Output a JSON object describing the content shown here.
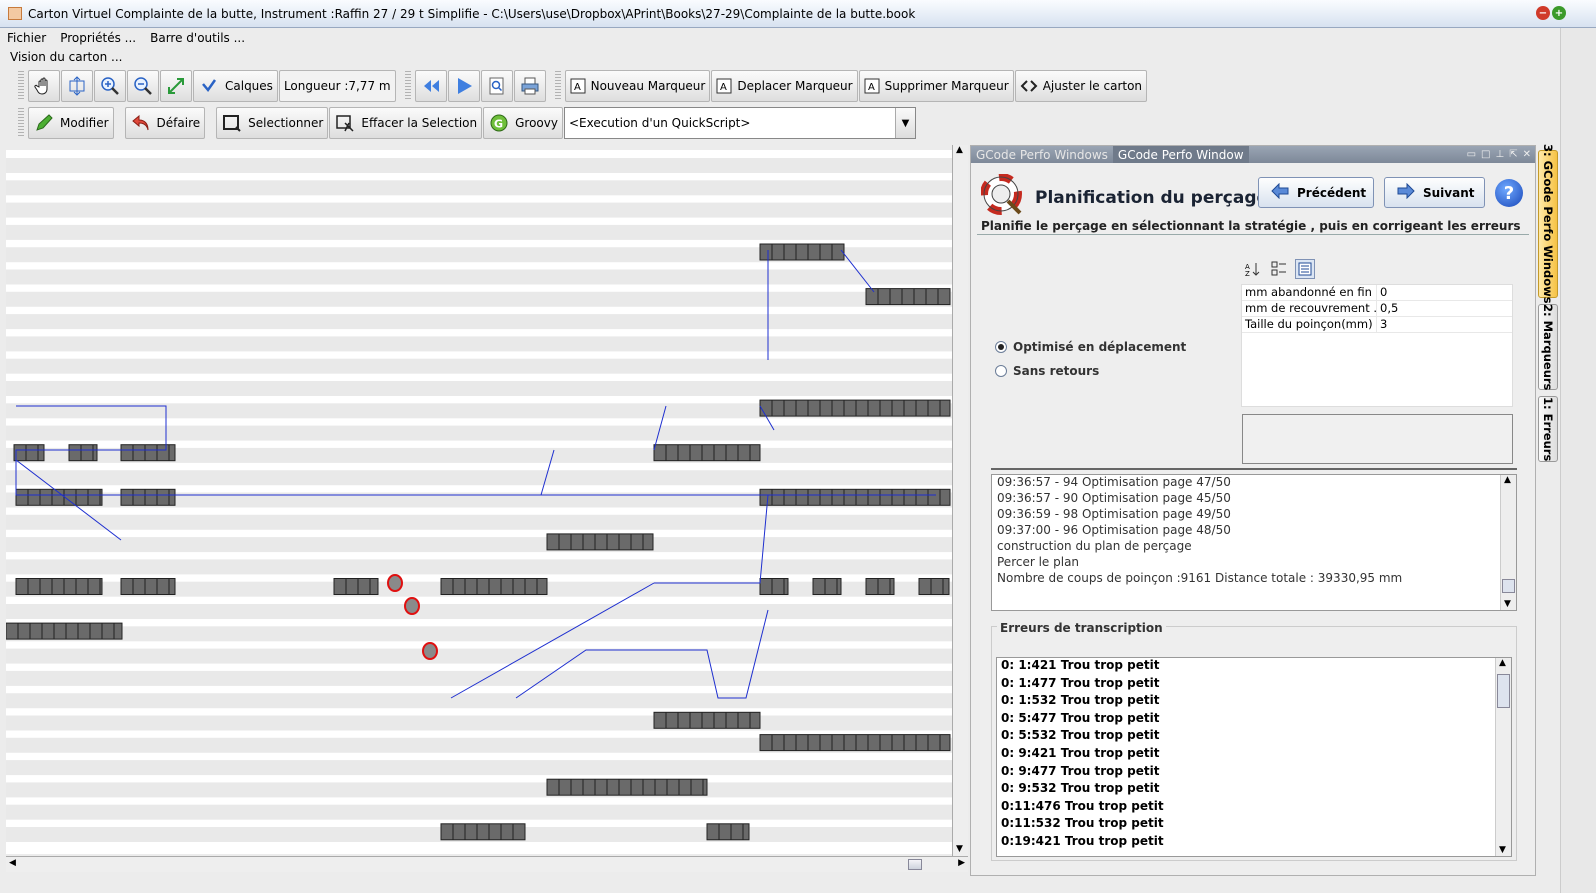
{
  "window": {
    "title": "Carton Virtuel  Complainte de la butte, Instrument :Raffin 27 / 29 t Simplifie - C:\\Users\\use\\Dropbox\\APrint\\Books\\27-29\\Complainte de la butte.book"
  },
  "menu": {
    "items": [
      "Fichier",
      "Propriétés ...",
      "Barre d'outils ..."
    ]
  },
  "vision_label": "Vision du carton ...",
  "toolbar1": {
    "calques": "Calques",
    "longueur": "Longueur :7,77 m",
    "nouveau_marqueur": "Nouveau Marqueur",
    "deplacer_marqueur": "Deplacer Marqueur",
    "supprimer_marqueur": "Supprimer Marqueur",
    "ajuster": "Ajuster le carton"
  },
  "toolbar2": {
    "modifier": "Modifier",
    "defaire": "Défaire",
    "selectionner": "Selectionner",
    "effacer": "Effacer la Selection",
    "groovy": "Groovy",
    "quickscript": "<Execution d'un QuickScript>"
  },
  "panel": {
    "tab_inactive": "GCode Perfo Windows",
    "tab_active": "GCode Perfo Window",
    "title": "Planification du perçage",
    "precedent": "Précédent",
    "suivant": "Suivant",
    "help": "?",
    "description": "Planifie le perçage en sélectionnant la stratégie , puis en corrigeant les erreurs",
    "options": [
      {
        "label": "Optimisé en déplacement",
        "selected": true
      },
      {
        "label": "Sans retours",
        "selected": false
      }
    ],
    "properties": [
      {
        "name": "mm abandonné en fin ...",
        "value": "0"
      },
      {
        "name": "mm de recouvrement ...",
        "value": "0,5"
      },
      {
        "name": "Taille du poinçon(mm)",
        "value": "3"
      }
    ],
    "log": [
      "09:36:57 - 94  Optimisation page 47/50",
      "09:36:57 - 90  Optimisation page 45/50",
      "09:36:59 - 98  Optimisation page 49/50",
      "09:37:00 - 96  Optimisation page 48/50",
      "construction du plan de perçage",
      "Percer le plan",
      "Nombre de coups de poinçon :9161   Distance totale : 39330,95 mm"
    ],
    "errors_title": "Erreurs de transcription",
    "errors": [
      "0: 1:421 Trou trop petit",
      "0: 1:477 Trou trop petit",
      "0: 1:532 Trou trop petit",
      "0: 5:477 Trou trop petit",
      "0: 5:532 Trou trop petit",
      "0: 9:421 Trou trop petit",
      "0: 9:477 Trou trop petit",
      "0: 9:532 Trou trop petit",
      "0:11:476 Trou trop petit",
      "0:11:532 Trou trop petit",
      "0:19:421 Trou trop petit"
    ]
  },
  "side_tabs": [
    "3: GCode Perfo Windows",
    "2: Marqueurs",
    "1: Erreurs"
  ]
}
